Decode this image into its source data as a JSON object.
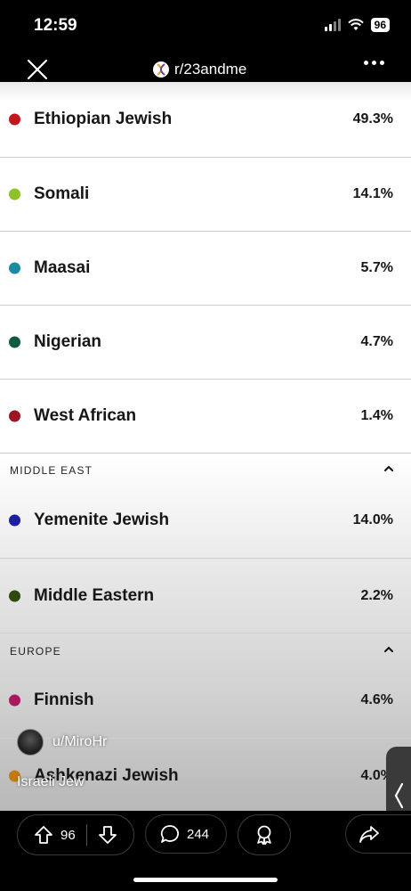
{
  "status_bar": {
    "time": "12:59",
    "battery": "96"
  },
  "nav": {
    "subreddit": "r/23andme",
    "close_icon": "close-icon",
    "more_icon": "more-icon"
  },
  "ancestry": {
    "rows_top": [
      {
        "name": "Ethiopian Jewish",
        "percent": "49.3%",
        "color": "#c3171f"
      },
      {
        "name": "Somali",
        "percent": "14.1%",
        "color": "#8cc228"
      },
      {
        "name": "Maasai",
        "percent": "5.7%",
        "color": "#1f8aa1"
      },
      {
        "name": "Nigerian",
        "percent": "4.7%",
        "color": "#0e5a45"
      },
      {
        "name": "West African",
        "percent": "1.4%",
        "color": "#9b1523"
      }
    ],
    "middle_east": {
      "heading": "MIDDLE EAST",
      "rows": [
        {
          "name": "Yemenite Jewish",
          "percent": "14.0%",
          "color": "#1b1fa0"
        },
        {
          "name": "Middle Eastern",
          "percent": "2.2%",
          "color": "#2e4b0c"
        }
      ]
    },
    "europe": {
      "heading": "EUROPE",
      "rows": [
        {
          "name": "Finnish",
          "percent": "4.6%",
          "color": "#a8185f"
        },
        {
          "name": "Ashkenazi Jewish",
          "percent": "4.0%",
          "color": "#c47b12"
        }
      ]
    }
  },
  "post": {
    "username": "u/MiroHr",
    "title": "Israeli Jew"
  },
  "actions": {
    "upvotes": "96",
    "comments": "244"
  }
}
